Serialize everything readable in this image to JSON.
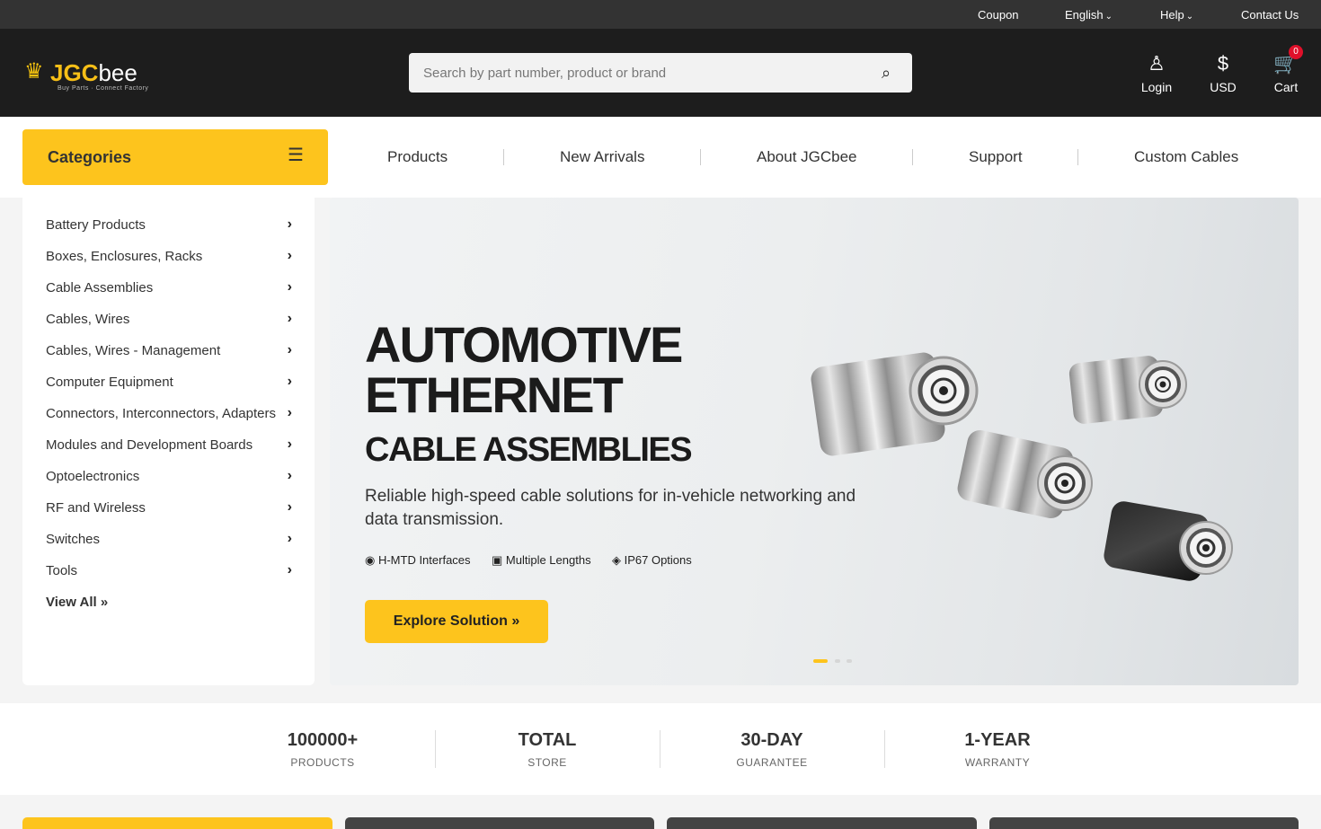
{
  "topbar": {
    "coupon": "Coupon",
    "language": "English",
    "help": "Help",
    "contact": "Contact Us"
  },
  "header": {
    "logo_part1": "JGC",
    "logo_part2": "bee",
    "tagline": "Buy Parts · Connect Factory",
    "search_placeholder": "Search by part number, product or brand",
    "login": "Login",
    "currency": "USD",
    "currency_symbol": "$",
    "cart": "Cart",
    "cart_count": "0"
  },
  "nav": {
    "categories": "Categories",
    "links": [
      "Products",
      "New Arrivals",
      "About JGCbee",
      "Support",
      "Custom Cables"
    ]
  },
  "sidebar": {
    "items": [
      "Battery Products",
      "Boxes, Enclosures, Racks",
      "Cable Assemblies",
      "Cables, Wires",
      "Cables, Wires - Management",
      "Computer Equipment",
      "Connectors, Interconnectors, Adapters",
      "Modules and Development Boards",
      "Optoelectronics",
      "RF and Wireless",
      "Switches",
      "Tools"
    ],
    "view_all": "View All »"
  },
  "hero": {
    "title_line1": "AUTOMOTIVE",
    "title_line2": "ETHERNET",
    "subtitle": "CABLE ASSEMBLIES",
    "description": "Reliable high-speed cable solutions for in-vehicle networking and data transmission.",
    "features": [
      "◉ H-MTD Interfaces",
      "▣ Multiple Lengths",
      "◈ IP67 Options"
    ],
    "cta": "Explore Solution »",
    "slide_count": 3,
    "active_slide": 0
  },
  "stats": [
    {
      "value": "100000+",
      "label": "PRODUCTS"
    },
    {
      "value": "TOTAL",
      "label": "STORE"
    },
    {
      "value": "30-DAY",
      "label": "GUARANTEE"
    },
    {
      "value": "1-YEAR",
      "label": "WARRANTY"
    }
  ],
  "colors": {
    "accent": "#fdc41d",
    "topbar": "#333333",
    "header": "#1d1d1d",
    "badge": "#e0102a"
  }
}
